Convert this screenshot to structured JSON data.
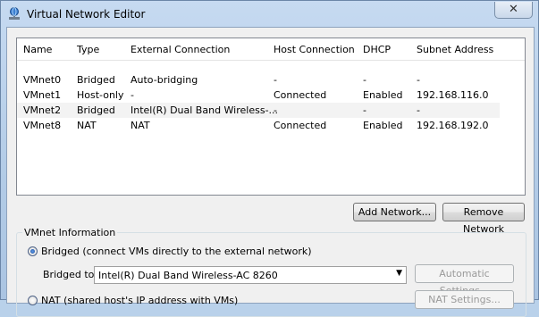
{
  "window": {
    "title": "Virtual Network Editor",
    "close_glyph": "✕"
  },
  "table": {
    "columns": [
      "Name",
      "Type",
      "External Connection",
      "Host Connection",
      "DHCP",
      "Subnet Address"
    ],
    "rows": [
      [
        "VMnet0",
        "Bridged",
        "Auto-bridging",
        "-",
        "-",
        "-"
      ],
      [
        "VMnet1",
        "Host-only",
        "-",
        "Connected",
        "Enabled",
        "192.168.116.0"
      ],
      [
        "VMnet2",
        "Bridged",
        "Intel(R) Dual Band Wireless-...",
        "-",
        "-",
        "-"
      ],
      [
        "VMnet8",
        "NAT",
        "NAT",
        "Connected",
        "Enabled",
        "192.168.192.0"
      ]
    ]
  },
  "buttons": {
    "add_network": "Add Network...",
    "remove_network": "Remove Network",
    "automatic_settings": "Automatic Settings...",
    "nat_settings": "NAT Settings..."
  },
  "vmnet_info": {
    "group_label": "VMnet Information",
    "bridged_option": "Bridged (connect VMs directly to the external network)",
    "bridged_to_label": "Bridged to:",
    "bridged_to_value": "Intel(R) Dual Band Wireless-AC 8260",
    "nat_option": "NAT (shared host's IP address with VMs)"
  }
}
